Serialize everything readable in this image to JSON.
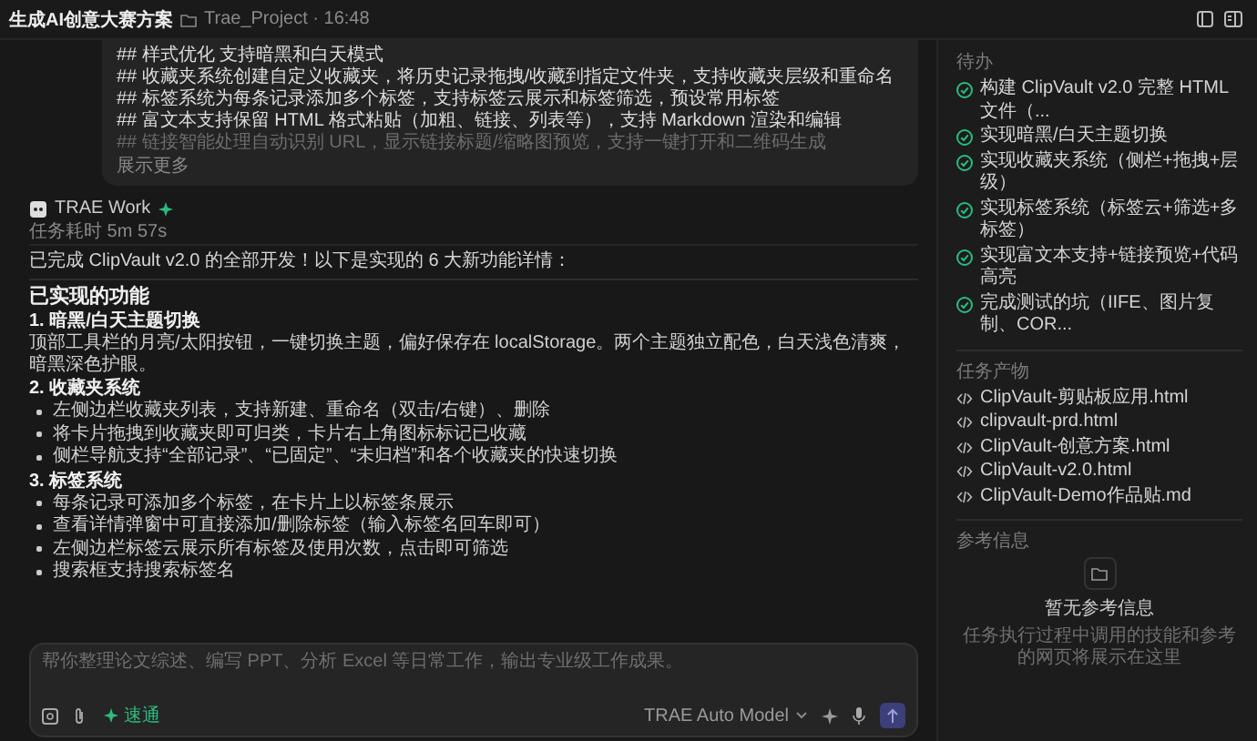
{
  "window": {
    "title": "生成AI创意大赛方案",
    "project": "Trae_Project · 16:48"
  },
  "user_message": {
    "lines": [
      {
        "text": "## 样式优化 支持暗黑和白天模式",
        "faded": false
      },
      {
        "text": "## 收藏夹系统创建自定义收藏夹，将历史记录拖拽/收藏到指定文件夹，支持收藏夹层级和重命名",
        "faded": false
      },
      {
        "text": "## 标签系统为每条记录添加多个标签，支持标签云展示和标签筛选，预设常用标签",
        "faded": false
      },
      {
        "text": "## 富文本支持保留 HTML 格式粘贴（加粗、链接、列表等），支持 Markdown 渲染和编辑",
        "faded": false
      },
      {
        "text": "## 链接智能处理自动识别 URL，显示链接标题/缩略图预览，支持一键打开和二维码生成",
        "faded": true
      }
    ],
    "expand": "展示更多"
  },
  "agent": {
    "name": "TRAE Work",
    "duration": "任务耗时 5m 57s",
    "intro": "已完成 ClipVault v2.0 的全部开发！以下是实现的 6 大新功能详情：",
    "blocks": [
      {
        "kind": "heading",
        "text": "已实现的功能"
      },
      {
        "kind": "subheading",
        "text": "1. 暗黑/白天主题切换"
      },
      {
        "kind": "paragraph",
        "text": "顶部工具栏的月亮/太阳按钮，一键切换主题，偏好保存在 localStorage。两个主题独立配色，白天浅色清爽，暗黑深色护眼。"
      },
      {
        "kind": "subheading",
        "text": "2. 收藏夹系统"
      },
      {
        "kind": "bullet",
        "text": "左侧边栏收藏夹列表，支持新建、重命名（双击/右键）、删除"
      },
      {
        "kind": "bullet",
        "text": "将卡片拖拽到收藏夹即可归类，卡片右上角图标标记已收藏"
      },
      {
        "kind": "bullet",
        "text": "侧栏导航支持“全部记录”、“已固定”、“未归档”和各个收藏夹的快速切换"
      },
      {
        "kind": "subheading",
        "text": "3. 标签系统"
      },
      {
        "kind": "bullet",
        "text": "每条记录可添加多个标签，在卡片上以标签条展示"
      },
      {
        "kind": "bullet",
        "text": "查看详情弹窗中可直接添加/删除标签（输入标签名回车即可）"
      },
      {
        "kind": "bullet",
        "text": "左侧边栏标签云展示所有标签及使用次数，点击即可筛选"
      },
      {
        "kind": "bullet",
        "text": "搜索框支持搜索标签名"
      }
    ]
  },
  "composer": {
    "placeholder": "帮你整理论文综述、编写 PPT、分析 Excel 等日常工作，输出专业级工作成果。",
    "mode": "速通",
    "model": "TRAE Auto Model"
  },
  "panel": {
    "todo": {
      "title": "待办",
      "items": [
        {
          "text": "构建 ClipVault v2.0 完整 HTML 文件（...",
          "checked": true
        },
        {
          "text": "实现暗黑/白天主题切换",
          "checked": true
        },
        {
          "text": "实现收藏夹系统（侧栏+拖拽+层级）",
          "checked": true
        },
        {
          "text": "实现标签系统（标签云+筛选+多标签）",
          "checked": true
        },
        {
          "text": "实现富文本支持+链接预览+代码高亮",
          "checked": true
        },
        {
          "text": "完成测试的坑（IIFE、图片复制、COR...",
          "checked": true
        }
      ]
    },
    "outputs": {
      "title": "任务产物",
      "files": [
        "ClipVault-剪贴板应用.html",
        "clipvault-prd.html",
        "ClipVault-创意方案.html",
        "ClipVault-v2.0.html",
        "ClipVault-Demo作品贴.md"
      ]
    },
    "references": {
      "title": "参考信息",
      "empty_title": "暂无参考信息",
      "empty_text": "任务执行过程中调用的技能和参考的网页将展示在这里"
    }
  }
}
